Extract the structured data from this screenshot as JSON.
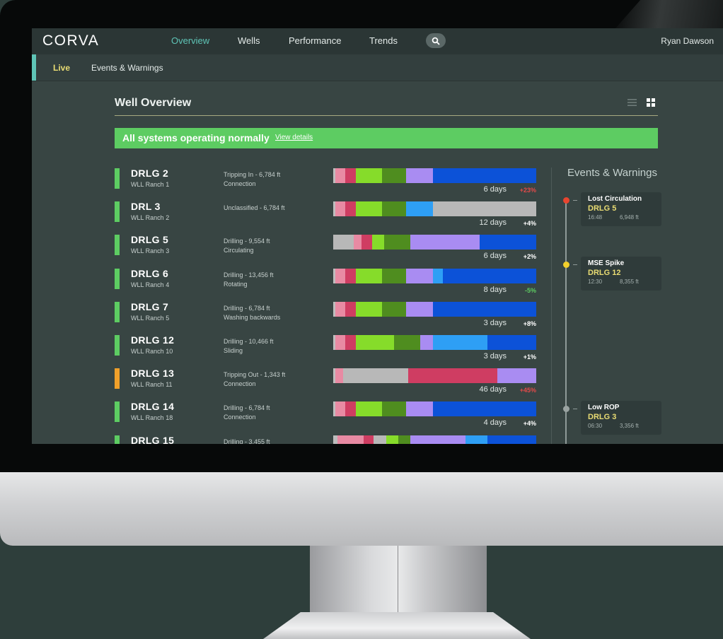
{
  "app": {
    "logo": "CORVA",
    "nav": [
      "Overview",
      "Wells",
      "Performance",
      "Trends"
    ],
    "user": "Ryan Dawson"
  },
  "subnav": [
    "Live",
    "Events & Warnings"
  ],
  "page_title": "Well Overview",
  "status": {
    "message": "All systems operating normally",
    "link": "View details",
    "color": "#5dcc62"
  },
  "segment_colors": {
    "g": "#bdbdbd",
    "p": "#e88aa3",
    "r": "#cf3d62",
    "lg": "#86dc2a",
    "dg": "#4f8d1f",
    "pu": "#a98cf2",
    "lb": "#2e9ff5",
    "b": "#0c52d8",
    "gr": "#b8b8b8"
  },
  "wells": [
    {
      "name": "DRLG 2",
      "ranch": "WLL Ranch 1",
      "activity": "Tripping In - 6,784 ft",
      "state": "Connection",
      "indicator": "#5dcc62",
      "days": "6 days",
      "delta": "+23%",
      "delta_color": "#e44a4a",
      "segments": [
        [
          "g",
          1
        ],
        [
          "p",
          5
        ],
        [
          "r",
          5
        ],
        [
          "lg",
          13
        ],
        [
          "dg",
          12
        ],
        [
          "pu",
          13
        ],
        [
          "b",
          51
        ]
      ]
    },
    {
      "name": "DRL 3",
      "ranch": "WLL Ranch 2",
      "activity": "Unclassified - 6,784 ft",
      "state": "",
      "indicator": "#5dcc62",
      "days": "12 days",
      "delta": "+4%",
      "delta_color": "#ffffff",
      "segments": [
        [
          "g",
          1
        ],
        [
          "p",
          5
        ],
        [
          "r",
          5
        ],
        [
          "lg",
          13
        ],
        [
          "dg",
          12
        ],
        [
          "lb",
          13
        ],
        [
          "gr",
          51
        ]
      ]
    },
    {
      "name": "DRLG 5",
      "ranch": "WLL Ranch 3",
      "activity": "Drilling - 9,554 ft",
      "state": "Circulating",
      "indicator": "#5dcc62",
      "days": "6 days",
      "delta": "+2%",
      "delta_color": "#ffffff",
      "segments": [
        [
          "gr",
          10
        ],
        [
          "p",
          4
        ],
        [
          "r",
          5
        ],
        [
          "lg",
          6
        ],
        [
          "dg",
          13
        ],
        [
          "pu",
          34
        ],
        [
          "b",
          28
        ]
      ]
    },
    {
      "name": "DRLG 6",
      "ranch": "WLL Ranch 4",
      "activity": "Drilling - 13,456 ft",
      "state": "Rotating",
      "indicator": "#5dcc62",
      "days": "8 days",
      "delta": "-5%",
      "delta_color": "#5dcc62",
      "segments": [
        [
          "g",
          1
        ],
        [
          "p",
          5
        ],
        [
          "r",
          5
        ],
        [
          "lg",
          13
        ],
        [
          "dg",
          12
        ],
        [
          "pu",
          13
        ],
        [
          "lb",
          5
        ],
        [
          "b",
          46
        ]
      ]
    },
    {
      "name": "DRLG 7",
      "ranch": "WLL Ranch 5",
      "activity": "Drilling - 6,784 ft",
      "state": "Washing backwards",
      "indicator": "#5dcc62",
      "days": "3 days",
      "delta": "+8%",
      "delta_color": "#ffffff",
      "segments": [
        [
          "g",
          1
        ],
        [
          "p",
          5
        ],
        [
          "r",
          5
        ],
        [
          "lg",
          13
        ],
        [
          "dg",
          12
        ],
        [
          "pu",
          13
        ],
        [
          "b",
          51
        ]
      ]
    },
    {
      "name": "DRLG 12",
      "ranch": "WLL Ranch 10",
      "activity": "Drilling - 10,466 ft",
      "state": "Sliding",
      "indicator": "#5dcc62",
      "days": "3 days",
      "delta": "+1%",
      "delta_color": "#ffffff",
      "segments": [
        [
          "g",
          1
        ],
        [
          "p",
          5
        ],
        [
          "r",
          5
        ],
        [
          "lg",
          19
        ],
        [
          "dg",
          13
        ],
        [
          "pu",
          6
        ],
        [
          "lb",
          27
        ],
        [
          "b",
          24
        ]
      ]
    },
    {
      "name": "DRLG 13",
      "ranch": "WLL Ranch 11",
      "activity": "Tripping Out - 1,343 ft",
      "state": "Connection",
      "indicator": "#f0a02a",
      "days": "46 days",
      "delta": "+45%",
      "delta_color": "#e44a4a",
      "segments": [
        [
          "g",
          1
        ],
        [
          "p",
          4
        ],
        [
          "gr",
          32
        ],
        [
          "r",
          44
        ],
        [
          "pu",
          19
        ]
      ]
    },
    {
      "name": "DRLG 14",
      "ranch": "WLL Ranch 18",
      "activity": "Drilling - 6,784 ft",
      "state": "Connection",
      "indicator": "#5dcc62",
      "days": "4 days",
      "delta": "+4%",
      "delta_color": "#ffffff",
      "segments": [
        [
          "g",
          1
        ],
        [
          "p",
          5
        ],
        [
          "r",
          5
        ],
        [
          "lg",
          13
        ],
        [
          "dg",
          12
        ],
        [
          "pu",
          13
        ],
        [
          "b",
          51
        ]
      ]
    },
    {
      "name": "DRLG 15",
      "ranch": "",
      "activity": "Drilling - 3,455 ft",
      "state": "",
      "indicator": "#5dcc62",
      "days": "",
      "delta": "",
      "delta_color": "#ffffff",
      "segments": [
        [
          "g",
          2
        ],
        [
          "p",
          13
        ],
        [
          "r",
          5
        ],
        [
          "gr",
          6
        ],
        [
          "lg",
          6
        ],
        [
          "dg",
          6
        ],
        [
          "pu",
          27
        ],
        [
          "lb",
          11
        ],
        [
          "b",
          24
        ]
      ]
    }
  ],
  "events": {
    "title": "Events & Warnings",
    "items": [
      {
        "type": "Lost Circulation",
        "well": "DRLG 5",
        "time": "16:48",
        "depth": "6,948 ft",
        "dot": "#e8452f"
      },
      {
        "type": "MSE Spike",
        "well": "DRLG 12",
        "time": "12:30",
        "depth": "8,355 ft",
        "dot": "#f2cf2b"
      },
      {
        "type": "Low ROP",
        "well": "DRLG 3",
        "time": "06:30",
        "depth": "3,356 ft",
        "dot": "#9aa3a1"
      }
    ]
  }
}
